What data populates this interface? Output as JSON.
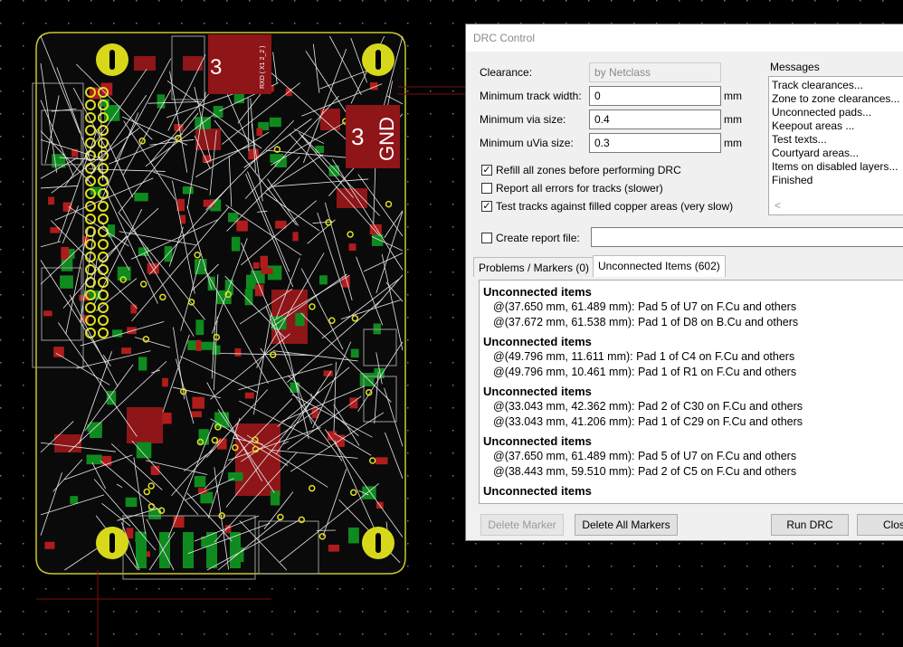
{
  "board": {
    "labels": [
      {
        "text": "3",
        "sub": "RXD ( X1 2_2 )"
      },
      {
        "text": "3",
        "sub": "GND"
      }
    ]
  },
  "drc": {
    "title": "DRC Control",
    "clearance_label": "Clearance:",
    "clearance_value": "by Netclass",
    "min_track_label": "Minimum track width:",
    "min_track_value": "0",
    "min_via_label": "Minimum via size:",
    "min_via_value": "0.4",
    "min_uvia_label": "Minimum uVia size:",
    "min_uvia_value": "0.3",
    "unit": "mm",
    "opt_refill": "Refill all zones before performing DRC",
    "opt_report_all": "Report all errors for tracks (slower)",
    "opt_test_tracks": "Test tracks against filled copper areas (very slow)",
    "create_report": "Create report file:",
    "report_path": "",
    "check_mark": "✓",
    "messages_label": "Messages",
    "messages": [
      "Track clearances...",
      "Zone to zone clearances...",
      "Unconnected pads...",
      "Keepout areas ...",
      "Test texts...",
      "Courtyard areas...",
      "Items on disabled layers...",
      "Finished"
    ],
    "scroll_left": "<",
    "tabs": [
      "Problems / Markers (0)",
      "Unconnected Items (602)"
    ],
    "unconnected": [
      {
        "title": "Unconnected items",
        "items": [
          "@(37.650 mm, 61.489 mm): Pad 5 of U7 on F.Cu and others",
          "@(37.672 mm, 61.538 mm): Pad 1 of D8 on B.Cu and others"
        ]
      },
      {
        "title": "Unconnected items",
        "items": [
          "@(49.796 mm, 11.611 mm): Pad 1 of C4 on F.Cu and others",
          "@(49.796 mm, 10.461 mm): Pad 1 of R1 on F.Cu and others"
        ]
      },
      {
        "title": "Unconnected items",
        "items": [
          "@(33.043 mm, 42.362 mm): Pad 2 of C30 on F.Cu and others",
          "@(33.043 mm, 41.206 mm): Pad 1 of C29 on F.Cu and others"
        ]
      },
      {
        "title": "Unconnected items",
        "items": [
          "@(37.650 mm, 61.489 mm): Pad 5 of U7 on F.Cu and others",
          "@(38.443 mm, 59.510 mm): Pad 2 of C5 on F.Cu and others"
        ]
      },
      {
        "title": "Unconnected items",
        "items": []
      }
    ],
    "btn_delete_marker": "Delete Marker",
    "btn_delete_all": "Delete All Markers",
    "btn_run": "Run DRC",
    "btn_close": "Close"
  }
}
